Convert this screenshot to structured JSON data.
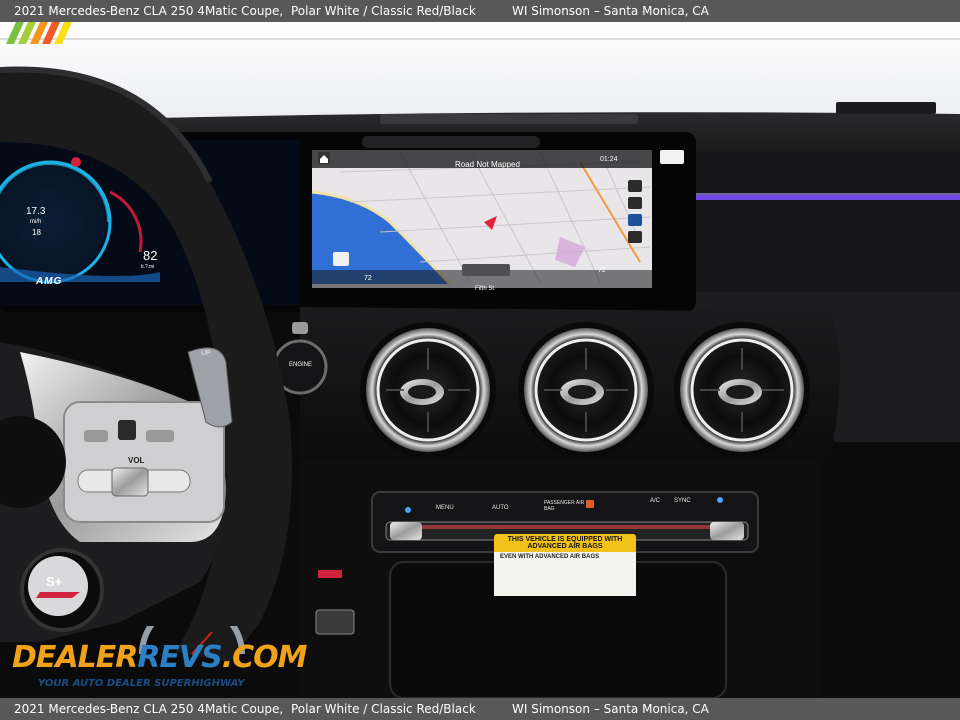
{
  "caption": {
    "vehicle": "2021 Mercedes-Benz CLA 250 4Matic Coupe,",
    "color": "Polar White / Classic Red/Black",
    "dealer": "WI Simonson – Santa Monica, CA"
  },
  "navigation": {
    "status": "Road Not Mapped",
    "time": "01:24",
    "street": "Fifth St",
    "temp_left": "72",
    "temp_right": "72"
  },
  "cluster": {
    "speed_top": "17.3",
    "speed_unit": "mi/h",
    "speed_bottom": "18",
    "badge": "AMG",
    "right_value": "82",
    "right_unit": "ti.?.mi"
  },
  "controls": {
    "engine_label": "ENGINE",
    "paddle_label": "UP",
    "volume_label": "VOL",
    "drive_mode": "S+",
    "hvac": [
      "MENU",
      "AUTO",
      "PASSENGER AIR BAG",
      "A/C",
      "SYNC"
    ]
  },
  "airbag_sticker": {
    "heading": "THIS VEHICLE IS EQUIPPED WITH ADVANCED AIR BAGS",
    "subheading": "EVEN WITH ADVANCED AIR BAGS"
  },
  "watermark": {
    "brand_part1": "DEALER",
    "brand_part2": "REVS",
    "brand_part3": ".COM",
    "tagline": "YOUR AUTO DEALER SUPERHIGHWAY"
  },
  "colors": {
    "ambient": "#7b4dff",
    "map_water": "#2f6fd6",
    "logo_orange": "#f0a21a",
    "logo_blue": "#2d7fc5"
  }
}
